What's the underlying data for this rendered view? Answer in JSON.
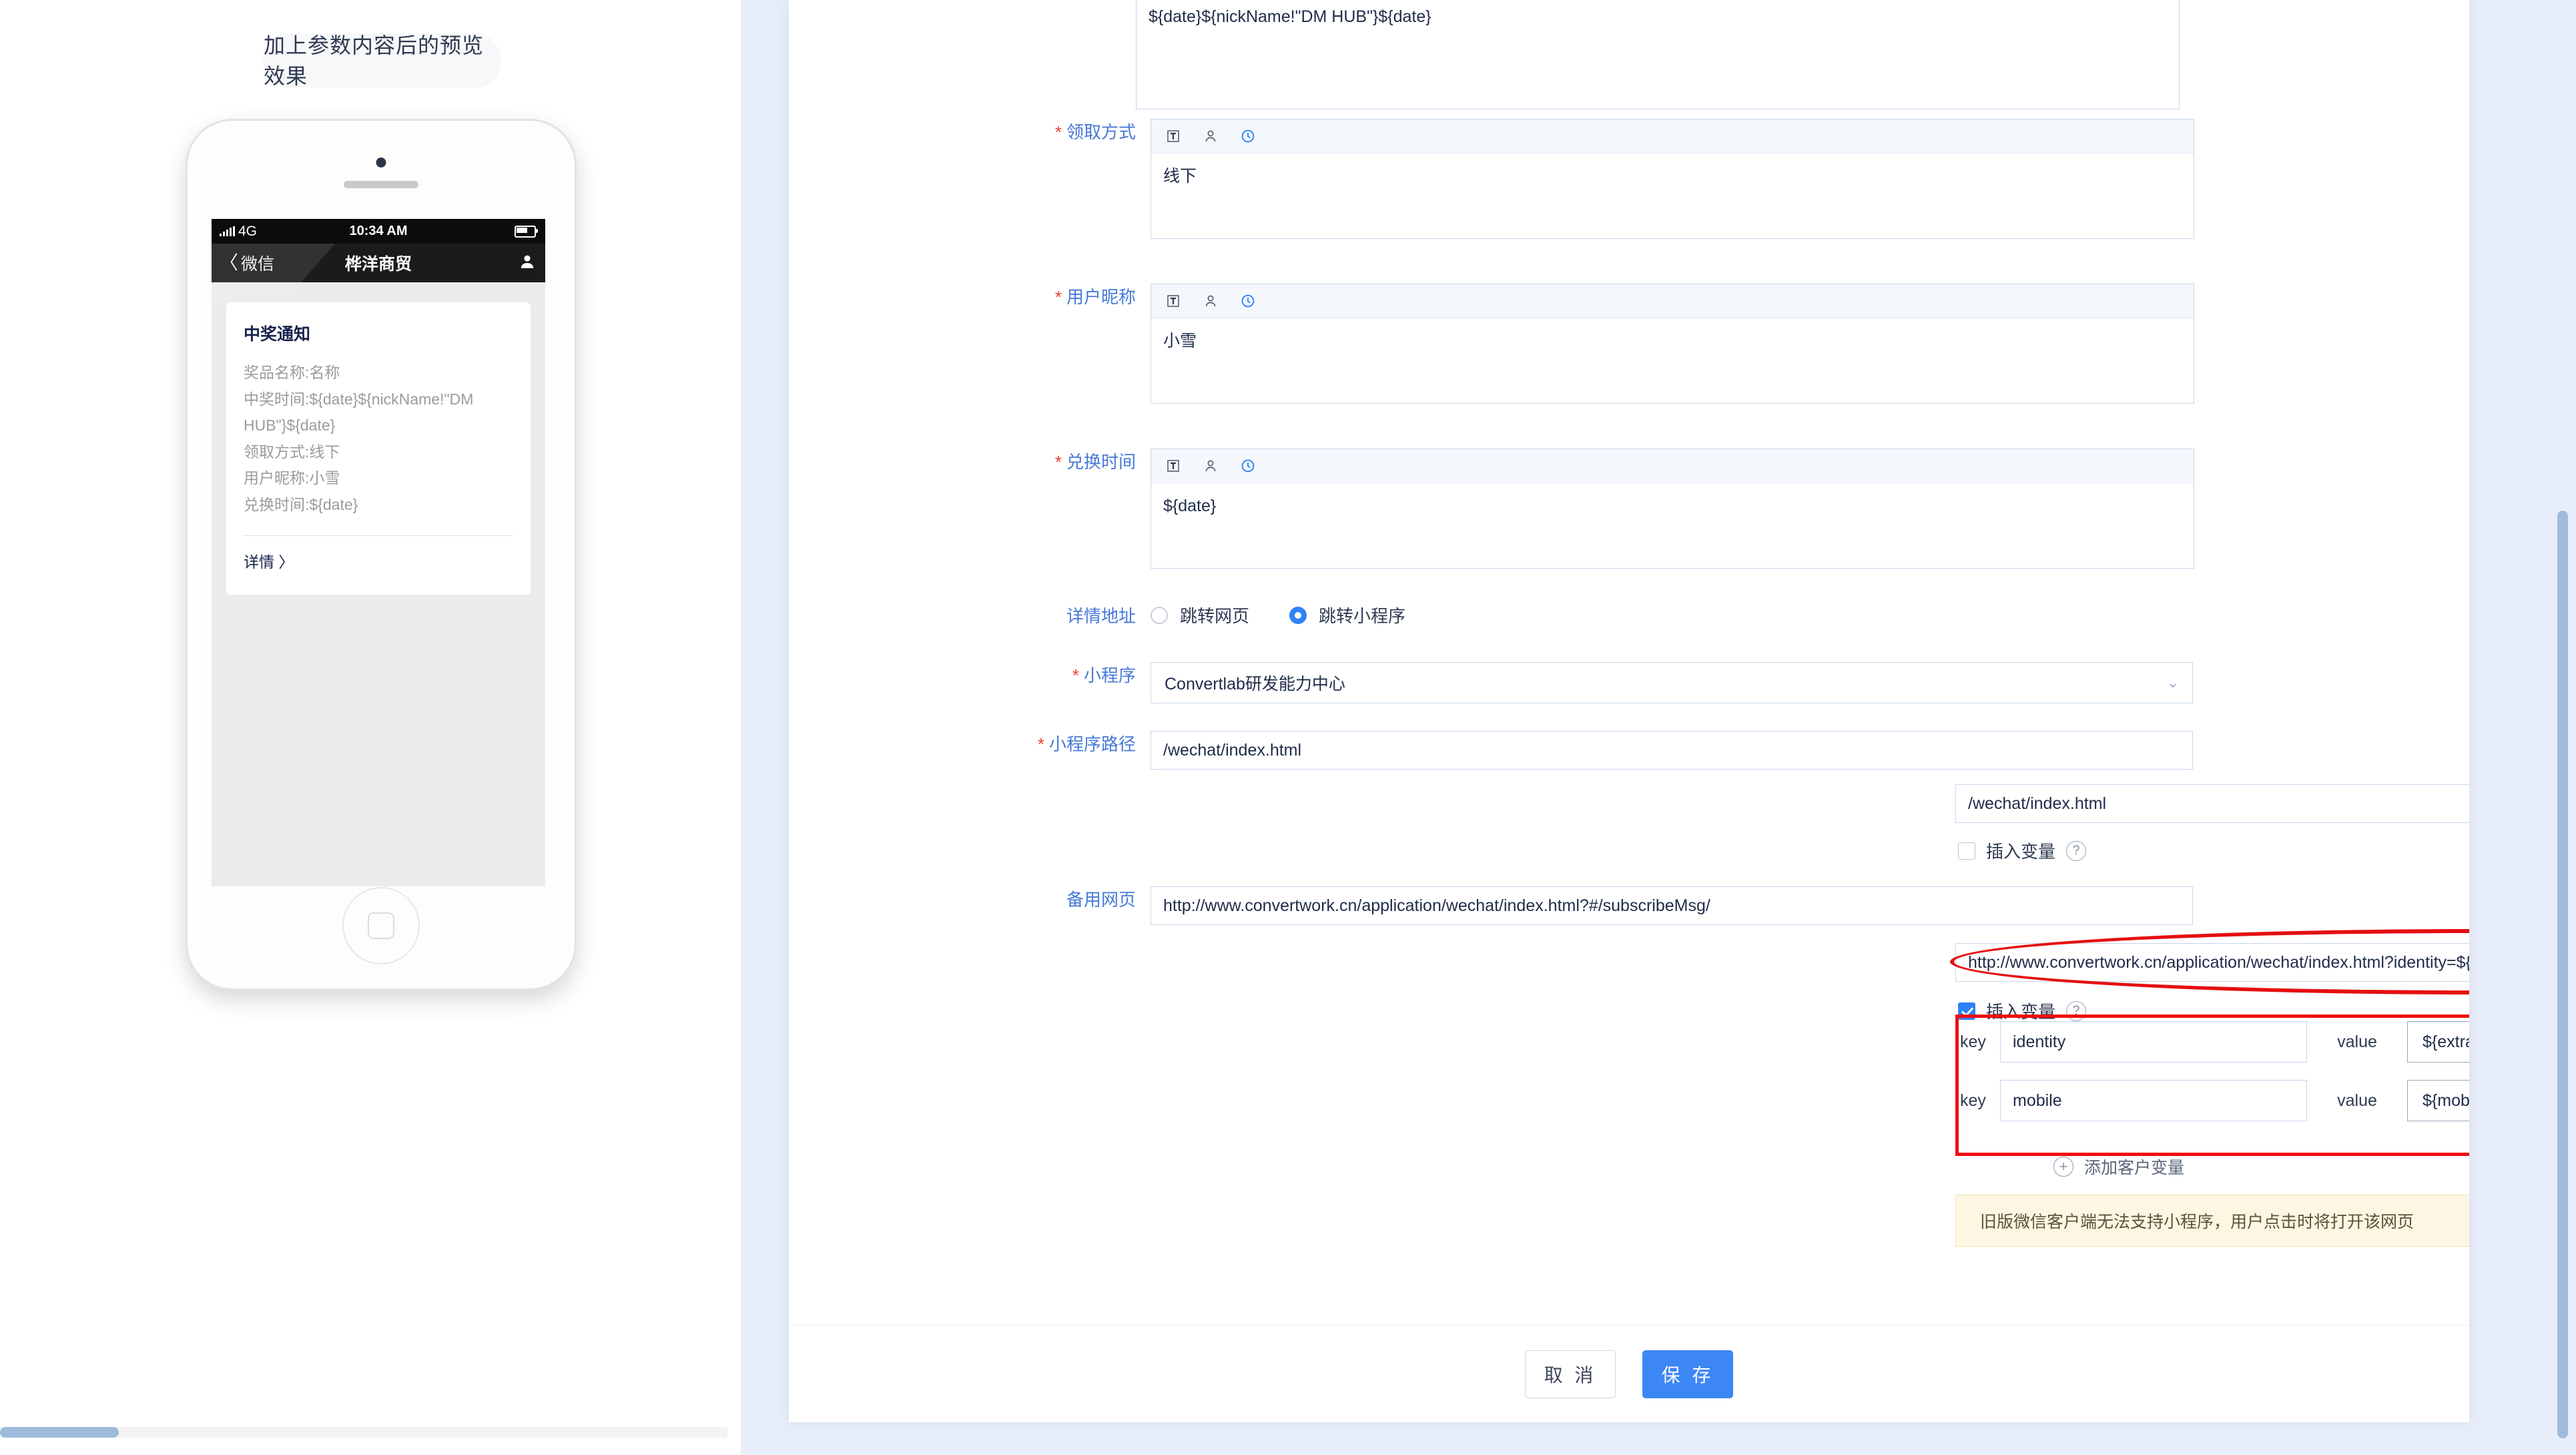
{
  "preview": {
    "badge_label": "加上参数内容后的预览效果",
    "phone": {
      "status": {
        "network": "4G",
        "time": "10:34 AM"
      },
      "nav": {
        "back_label": "微信",
        "title": "桦洋商贸",
        "back_icon": "chevron-left-icon",
        "profile_icon": "person-icon"
      },
      "card": {
        "title": "中奖通知",
        "lines": [
          "奖品名称:名称",
          "中奖时间:${date}${nickName!\"DM HUB\"}${date}",
          "领取方式:线下",
          "用户昵称:小雪",
          "兑换时间:${date}"
        ],
        "detail_link": "详情 〉"
      }
    }
  },
  "form": {
    "top_editor": {
      "value": "${date}${nickName!\"DM HUB\"}${date}"
    },
    "fields": [
      {
        "label": "领取方式",
        "required": true,
        "value": "线下"
      },
      {
        "label": "用户昵称",
        "required": true,
        "value": "小雪"
      },
      {
        "label": "兑换时间",
        "required": true,
        "value": "${date}"
      }
    ],
    "toolbar_icons": [
      "insert-text-variable-icon",
      "person-icon",
      "clock-icon"
    ],
    "detail_address": {
      "label": "详情地址",
      "options": [
        {
          "label": "跳转网页",
          "selected": false
        },
        {
          "label": "跳转小程序",
          "selected": true
        }
      ]
    },
    "miniprogram": {
      "label": "小程序",
      "required": true,
      "value": "Convertlab研发能力中心",
      "chevron": "chevron-down-icon"
    },
    "miniprogram_path": {
      "label": "小程序路径",
      "required": true,
      "value": "/wechat/index.html",
      "preview_value": "/wechat/index.html",
      "insert_var_label": "插入变量",
      "insert_var_checked": false,
      "help_icon": "question-mark-icon"
    },
    "backup_page": {
      "label": "备用网页",
      "value": "http://www.convertwork.cn/application/wechat/index.html?#/subscribeMsg/",
      "preview_value": "http://www.convertwork.cn/application/wechat/index.html?identity=${extra.wechatOpenId}&mobile=${mobile}#/subscribeMsg/",
      "insert_var_label": "插入变量",
      "insert_var_checked": true,
      "help_icon": "question-mark-icon"
    },
    "variables": {
      "key_label": "key",
      "value_label": "value",
      "rows": [
        {
          "key": "identity",
          "value": "${extra.wechatOpenId}"
        },
        {
          "key": "mobile",
          "value": "${mobile}"
        }
      ],
      "remove_icon": "minus-circle-icon",
      "add_label": "添加客户变量",
      "add_icon": "plus-circle-icon"
    },
    "warning": "旧版微信客户端无法支持小程序，用户点击时将打开该网页",
    "footer": {
      "cancel": "取 消",
      "save": "保 存"
    }
  },
  "colors": {
    "primary": "#3d87f5",
    "label": "#4779d6",
    "required": "#f04134",
    "annotation": "#ef0d0d",
    "warning_bg": "#fdf6e3"
  }
}
